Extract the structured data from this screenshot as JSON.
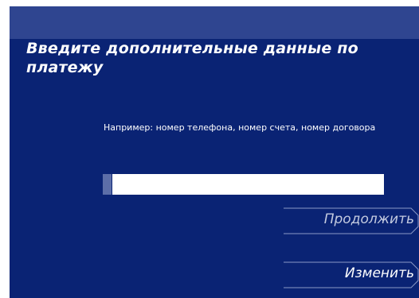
{
  "screen": {
    "title": "Введите дополнительные данные по платежу",
    "hint": "Например: номер телефона, номер счета, номер договора"
  },
  "payment_field": {
    "value": "",
    "placeholder": ""
  },
  "actions": {
    "continue_label": "Продолжить",
    "change_label": "Изменить"
  },
  "colors": {
    "background": "#0a2374",
    "top_band": "#2f4590",
    "continue_text": "#c4cbe0",
    "button_outline": "#8a98c6"
  }
}
